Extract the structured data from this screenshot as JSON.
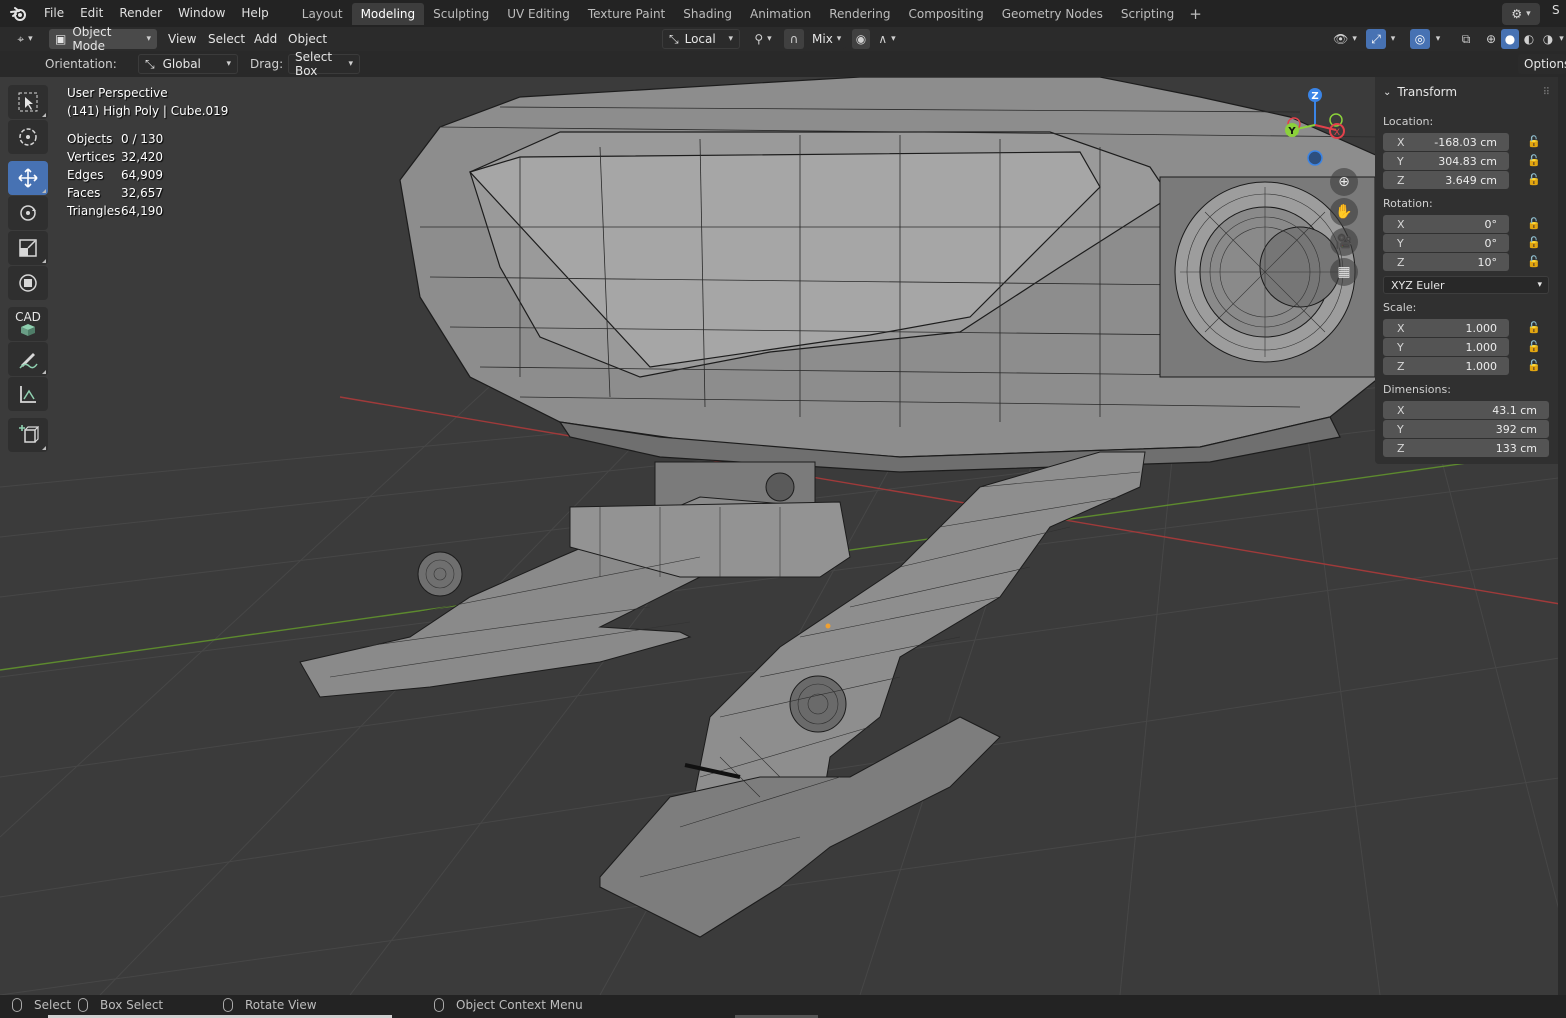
{
  "topbar": {
    "menus": [
      "File",
      "Edit",
      "Render",
      "Window",
      "Help"
    ],
    "workspaces": [
      "Layout",
      "Modeling",
      "Sculpting",
      "UV Editing",
      "Texture Paint",
      "Shading",
      "Animation",
      "Rendering",
      "Compositing",
      "Geometry Nodes",
      "Scripting"
    ],
    "active_workspace": "Modeling",
    "add_label": "+"
  },
  "header": {
    "mode": "Object Mode",
    "menus": [
      "View",
      "Select",
      "Add",
      "Object"
    ],
    "transform_pivot": "Local",
    "proportional": "Mix"
  },
  "tool_settings": {
    "orientation_label": "Orientation:",
    "orientation_value": "Global",
    "drag_label": "Drag:",
    "drag_value": "Select Box",
    "options_label": "Options"
  },
  "toolbar": {
    "cad_label": "CAD"
  },
  "overlay": {
    "view_name": "User Perspective",
    "object_info": "(141) High Poly | Cube.019",
    "stats": [
      {
        "key": "Objects",
        "value": "0 / 130"
      },
      {
        "key": "Vertices",
        "value": "32,420"
      },
      {
        "key": "Edges",
        "value": "64,909"
      },
      {
        "key": "Faces",
        "value": "32,657"
      },
      {
        "key": "Triangles",
        "value": "64,190"
      }
    ]
  },
  "gizmo": {
    "x": "X",
    "y": "Y",
    "z": "Z",
    "colors": {
      "x": "#e2414b",
      "y": "#8bd13b",
      "z": "#3a84e6"
    }
  },
  "npanel": {
    "title": "Transform",
    "location_label": "Location:",
    "location": [
      {
        "axis": "X",
        "value": "-168.03 cm"
      },
      {
        "axis": "Y",
        "value": "304.83 cm"
      },
      {
        "axis": "Z",
        "value": "3.649 cm"
      }
    ],
    "rotation_label": "Rotation:",
    "rotation": [
      {
        "axis": "X",
        "value": "0°"
      },
      {
        "axis": "Y",
        "value": "0°"
      },
      {
        "axis": "Z",
        "value": "10°"
      }
    ],
    "rotation_mode": "XYZ Euler",
    "scale_label": "Scale:",
    "scale": [
      {
        "axis": "X",
        "value": "1.000"
      },
      {
        "axis": "Y",
        "value": "1.000"
      },
      {
        "axis": "Z",
        "value": "1.000"
      }
    ],
    "dimensions_label": "Dimensions:",
    "dimensions": [
      {
        "axis": "X",
        "value": "43.1 cm"
      },
      {
        "axis": "Y",
        "value": "392 cm"
      },
      {
        "axis": "Z",
        "value": "133 cm"
      }
    ]
  },
  "statusbar": {
    "select": "Select",
    "box_select": "Box Select",
    "rotate_view": "Rotate View",
    "context_menu": "Object Context Menu"
  },
  "colors": {
    "accent": "#4772b3",
    "x_axis_line": "#a03a3a",
    "y_axis_line": "#5d8a2e"
  }
}
